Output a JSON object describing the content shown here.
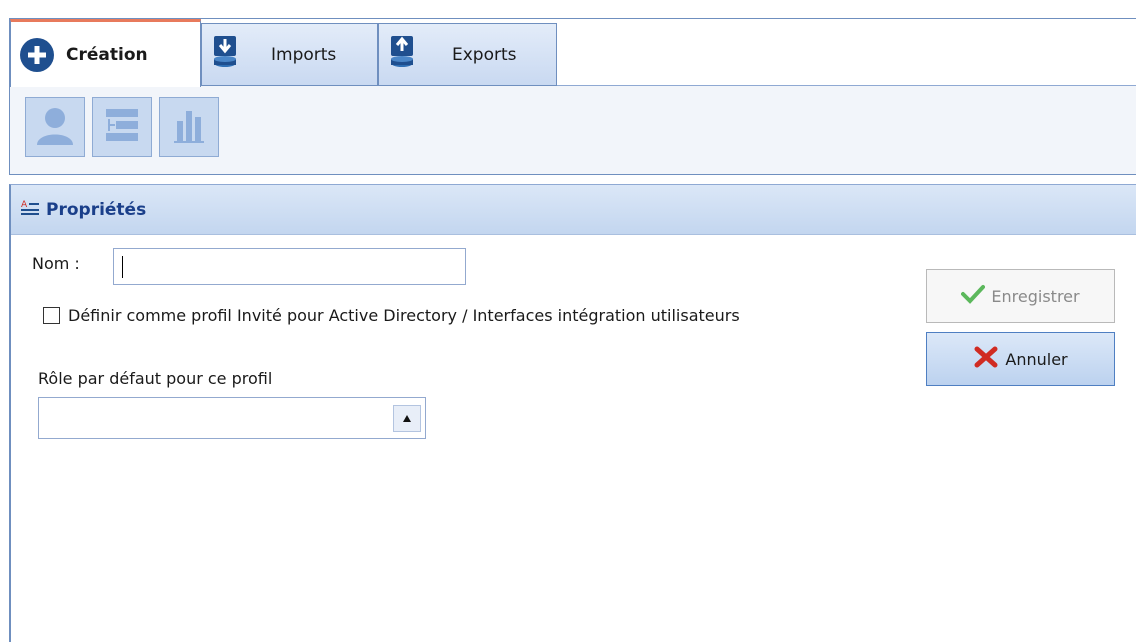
{
  "tabs": {
    "creation": "Création",
    "imports": "Imports",
    "exports": "Exports"
  },
  "toolbar": {
    "icons": [
      "user-icon",
      "hierarchy-icon",
      "chart-icon"
    ]
  },
  "panel": {
    "title": "Propriétés"
  },
  "form": {
    "nom_label": "Nom :",
    "nom_value": "",
    "guest_checkbox_label": "Définir comme profil Invité pour Active Directory / Interfaces intégration utilisateurs",
    "guest_checked": false,
    "role_label": "Rôle par défaut pour ce profil",
    "role_value": ""
  },
  "buttons": {
    "save": "Enregistrer",
    "cancel": "Annuler"
  },
  "colors": {
    "accent_blue": "#1f4f8f",
    "header_title": "#1a3f8a",
    "active_tab_top": "#e87a5c",
    "check_green": "#5cb85c",
    "cancel_red": "#d02b22"
  }
}
